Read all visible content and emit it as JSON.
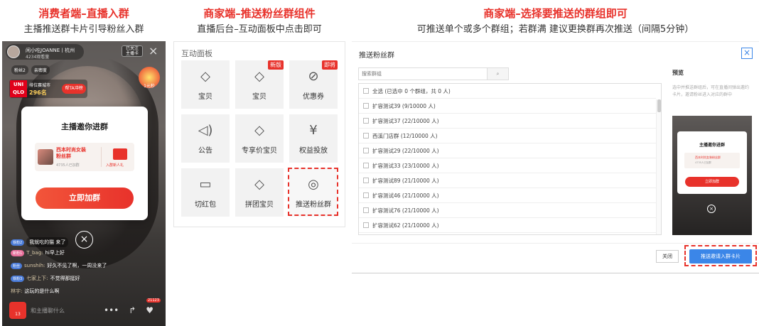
{
  "captions": {
    "consumer": {
      "title": "消费者端–直播入群",
      "sub": "主播推送群卡片引导粉丝入群"
    },
    "merchant_panel": {
      "title": "商家端–推送粉丝群组件",
      "sub": "直播后台–互动面板中点击即可"
    },
    "merchant_select": {
      "title": "商家端–选择要推送的群组即可",
      "sub": "可推送单个或多个群组；若群满 建议更换群再次推送（间隔5分钟）"
    }
  },
  "phone": {
    "host_name": "闲小吃JOANNE丨杭州",
    "host_sub": "4234观看量",
    "follow_label": "已关注\n主播卡",
    "close_glyph": "×",
    "tags": [
      "粉丝2",
      "亲密度"
    ],
    "uniqlo": {
      "logo": "UNI\nQLO",
      "line1": "排位赛城市",
      "line2": "296名",
      "btn": "帮TA冲榜"
    },
    "gift_label": "1元秒",
    "invite": {
      "title": "主播邀你进群",
      "group_name": "西本时尚女装\n粉丝群",
      "group_count": "4735人已加群",
      "group_action": "入群新人礼",
      "join_label": "立即加群"
    },
    "card_close_glyph": "×",
    "chats": [
      {
        "lvl": "铁粉2",
        "pink": false,
        "name": "",
        "text": "我就吃的猫 来了"
      },
      {
        "lvl": "新粉1",
        "pink": true,
        "name": "T_bag:",
        "text": " hi早上好"
      },
      {
        "lvl": "粉丝",
        "pink": false,
        "name": "sunshih:",
        "text": " 好久不见了啊，一周没来了"
      },
      {
        "lvl": "铁粉3",
        "pink": false,
        "name": "七家上下:",
        "text": " 不觉得那挺好"
      },
      {
        "lvl": "",
        "pink": false,
        "name": "林宇:",
        "text": " 这玩的是什么啊"
      }
    ],
    "shop_count": "13",
    "comment_placeholder": "和主播聊什么",
    "bottom_icons": [
      "•••",
      "↱",
      "♥"
    ],
    "like_count": "21123"
  },
  "panel": {
    "title": "互动面板",
    "tiles": [
      {
        "label": "宝贝",
        "icon": "◇",
        "tag": ""
      },
      {
        "label": "宝贝",
        "icon": "◇",
        "tag": "新版"
      },
      {
        "label": "优惠券",
        "icon": "⊘",
        "tag": "即将"
      },
      {
        "label": "公告",
        "icon": "◁)",
        "tag": ""
      },
      {
        "label": "专享价宝贝",
        "icon": "◇",
        "tag": ""
      },
      {
        "label": "权益投放",
        "icon": "¥",
        "tag": ""
      },
      {
        "label": "切红包",
        "icon": "▭",
        "tag": ""
      },
      {
        "label": "拼团宝贝",
        "icon": "◇",
        "tag": ""
      },
      {
        "label": "推送粉丝群",
        "icon": "◎",
        "tag": ""
      }
    ]
  },
  "dialog": {
    "title": "推送粉丝群",
    "close_glyph": "×",
    "search_placeholder": "搜索群组",
    "search_icon": "⌕",
    "select_all": "全选 (已选中 0 个群组，共 0 人)",
    "groups": [
      "扩容测试39 (9/10000 人)",
      "扩容测试37 (22/10000 人)",
      "西溪门店群 (12/10000 人)",
      "扩容测试29 (22/10000 人)",
      "扩容测试33 (23/10000 人)",
      "扩容测试89 (21/10000 人)",
      "扩容测试46 (21/10000 人)",
      "扩容测试76 (21/10000 人)",
      "扩容测试62 (21/10000 人)"
    ],
    "preview_label": "预览",
    "preview_desc": "选中并推送群组后，可在直播间弹出邀约卡片，邀请粉丝进入对应的群中",
    "preview": {
      "title": "主播邀你进群",
      "group_name": "西本时尚女装粉丝群",
      "group_count": "4735人已加群",
      "btn": "立即加群",
      "close_glyph": "×"
    },
    "cancel_label": "关闭",
    "push_label": "推送邀请入群卡片"
  },
  "colors": {
    "accent": "#e8322b",
    "primary_blue": "#3b86e8"
  }
}
